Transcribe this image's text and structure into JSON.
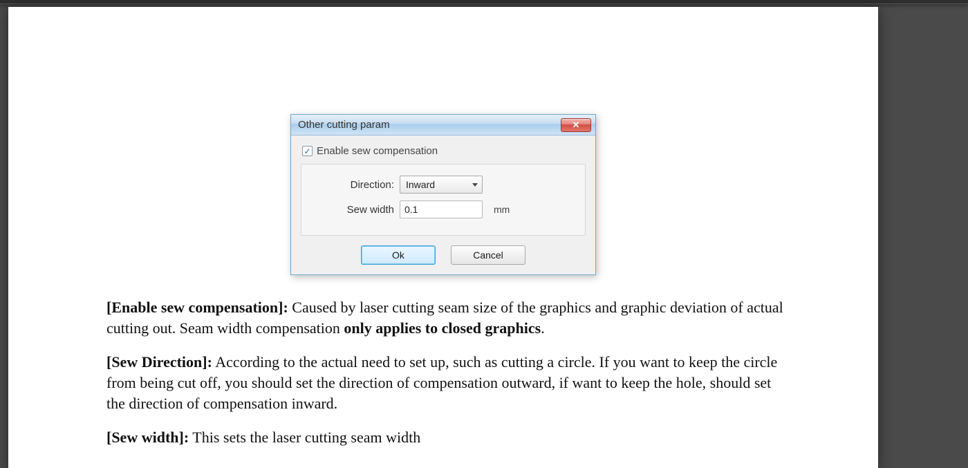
{
  "dialog": {
    "title": "Other cutting param",
    "close_icon": "✕",
    "checkbox": {
      "checked": true,
      "mark": "✓",
      "label": "Enable sew compensation"
    },
    "fields": {
      "direction_label": "Direction:",
      "direction_value": "Inward",
      "sew_width_label": "Sew width",
      "sew_width_value": "0.1",
      "sew_width_unit": "mm"
    },
    "buttons": {
      "ok": "Ok",
      "cancel": "Cancel"
    }
  },
  "text": {
    "p1_label": "[Enable sew compensation]:",
    "p1_a": " Caused by laser cutting seam size of the graphics and graphic deviation of actual cutting out. Seam width compensation ",
    "p1_bold": "only applies to closed graphics",
    "p1_b": ".",
    "p2_label": "[Sew Direction]:",
    "p2_body": " According to the actual need to set up, such as cutting a circle. If you want to keep the circle from being cut off, you should set the direction of compensation outward, if want to keep the hole, should set the direction of compensation inward.",
    "p3_label": "[Sew width]:",
    "p3_body": " This sets the laser cutting seam width"
  }
}
